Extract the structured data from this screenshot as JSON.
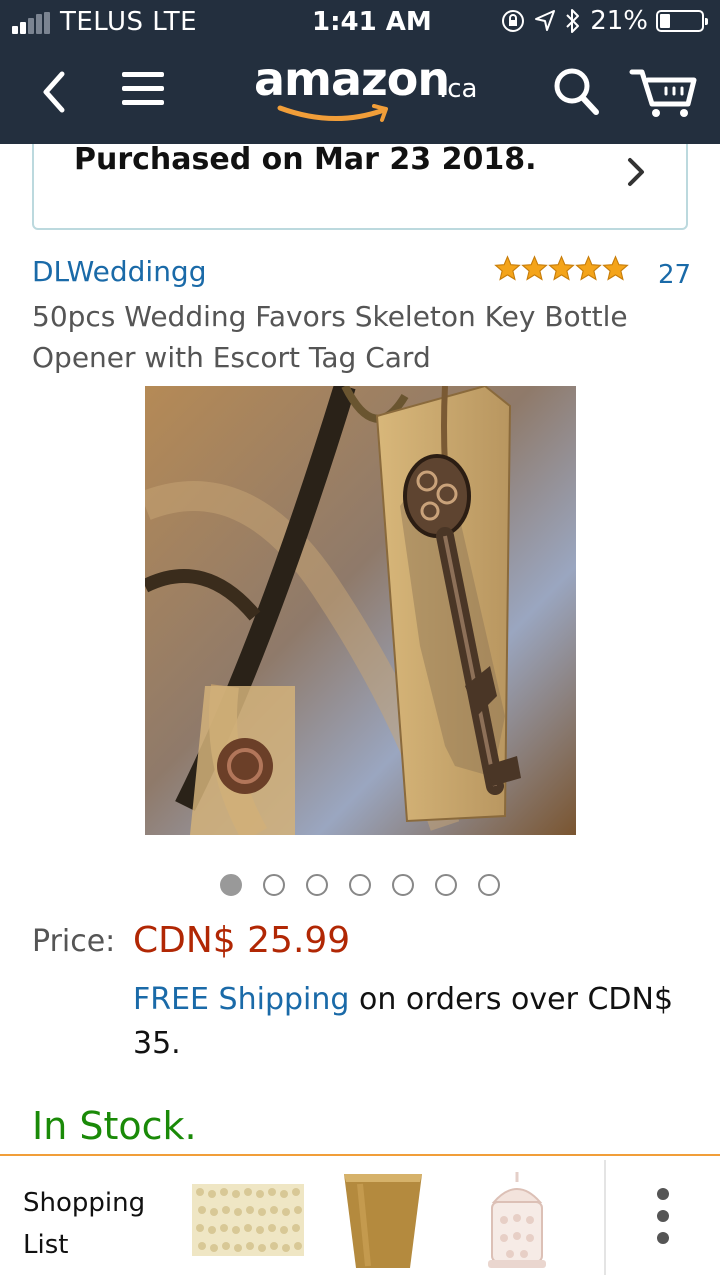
{
  "status_bar": {
    "carrier": "TELUS  LTE",
    "time": "1:41 AM",
    "battery": "21%"
  },
  "nav": {
    "logo_word": "amazon",
    "logo_tld": ".ca",
    "colors": {
      "background": "#232f3e",
      "smile": "#f19e39"
    }
  },
  "purchase_banner": {
    "text": "Purchased on Mar 23 2018."
  },
  "product": {
    "brand": "DLWeddingg",
    "rating_stars": 5,
    "rating_count": "27",
    "title": "50pcs Wedding Favors Skeleton Key Bottle Opener with Escort Tag Card",
    "image_count": 7,
    "active_image": 1,
    "price_label": "Price:",
    "price": "CDN$ 25.99",
    "shipping_link": "FREE Shipping",
    "shipping_text": " on orders over CDN$ 35.",
    "availability": "In Stock."
  },
  "bottom_bar": {
    "label_line1": "Shopping",
    "label_line2": "List",
    "thumbs": [
      "pearl-strands-thumbnail",
      "gold-cup-thumbnail",
      "birdcage-candle-holder-thumbnail"
    ]
  },
  "colors": {
    "price": "#b12704",
    "link": "#1a6aa8",
    "in_stock": "#1a8a08",
    "star": "#f4a41a",
    "accent_line": "#f19e39"
  }
}
